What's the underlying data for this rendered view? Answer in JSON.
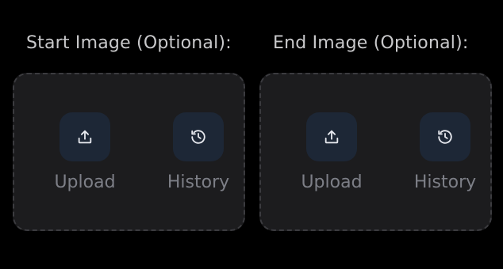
{
  "panels": [
    {
      "label": "Start Image (Optional):",
      "upload_label": "Upload",
      "history_label": "History",
      "upload_icon": "upload-icon",
      "history_icon": "history-icon"
    },
    {
      "label": "End Image (Optional):",
      "upload_label": "Upload",
      "history_label": "History",
      "upload_icon": "upload-icon",
      "history_icon": "history-icon"
    }
  ],
  "colors": {
    "background": "#000000",
    "dropzone_bg": "#1c1c1e",
    "dropzone_border": "#3b3b3f",
    "icon_tile_bg": "#1d2736",
    "icon_stroke": "#e6e8ee",
    "label_text": "#c9c9cb",
    "action_text": "#7d7f87"
  }
}
